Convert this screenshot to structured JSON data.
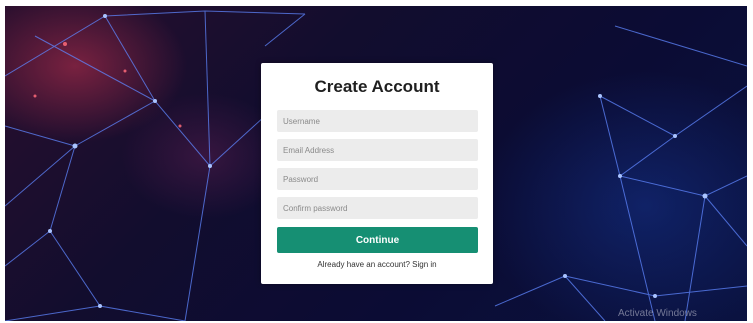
{
  "form": {
    "title": "Create Account",
    "username_placeholder": "Username",
    "email_placeholder": "Email Address",
    "password_placeholder": "Password",
    "confirm_placeholder": "Confirm password",
    "continue_label": "Continue",
    "signin_prompt": "Already have an account?",
    "signin_link": "Sign in"
  },
  "watermark": {
    "text": "Activate Windows"
  },
  "colors": {
    "accent": "#168f73",
    "field_bg": "#ececec",
    "card_bg": "#ffffff",
    "background": "#0b0c34"
  }
}
